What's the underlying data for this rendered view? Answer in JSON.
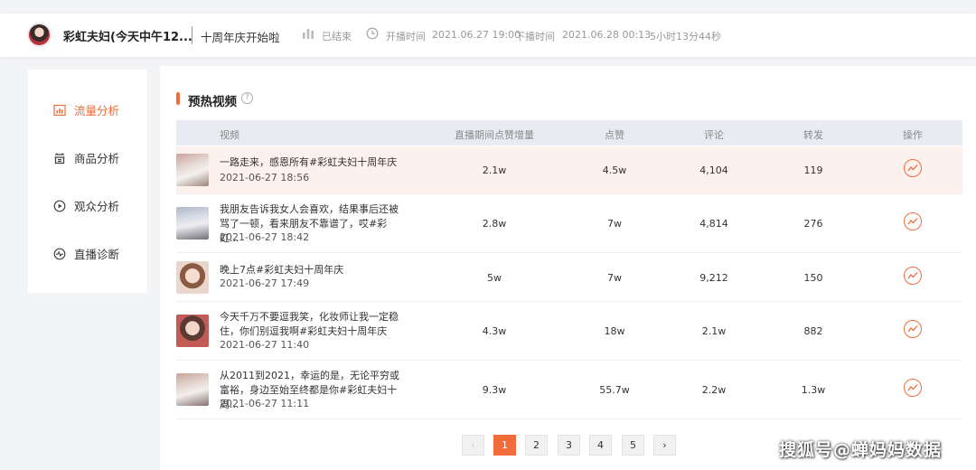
{
  "header": {
    "anchor_name": "彩虹夫妇(今天中午12...",
    "live_title": "十周年庆开始啦",
    "status": "已结束",
    "start_label": "开播时间",
    "start_time": "2021.06.27 19:00",
    "end_label": "下播时间",
    "end_time": "2021.06.28 00:13",
    "duration": "5小时13分44秒"
  },
  "sidebar": {
    "items": [
      {
        "label": "流量分析",
        "icon": "bar-chart-icon",
        "active": true
      },
      {
        "label": "商品分析",
        "icon": "goods-icon",
        "active": false
      },
      {
        "label": "观众分析",
        "icon": "play-circle-icon",
        "active": false
      },
      {
        "label": "直播诊断",
        "icon": "diagnose-icon",
        "active": false
      }
    ]
  },
  "section": {
    "title": "预热视频",
    "help": "?"
  },
  "table": {
    "headers": [
      "视频",
      "直播期间点赞增量",
      "点赞",
      "评论",
      "转发",
      "操作"
    ],
    "rows": [
      {
        "title": "一路走来，感恩所有#彩虹夫妇十周年庆",
        "date": "2021-06-27 18:56",
        "like_increase": "2.1w",
        "likes": "4.5w",
        "comments": "4,104",
        "shares": "119"
      },
      {
        "title": "我朋友告诉我女人会喜欢，结果事后还被骂了一顿，看来朋友不靠谱了，哎#彩虹...",
        "date": "2021-06-27 18:42",
        "like_increase": "2.8w",
        "likes": "7w",
        "comments": "4,814",
        "shares": "276"
      },
      {
        "title": "晚上7点#彩虹夫妇十周年庆",
        "date": "2021-06-27 17:49",
        "like_increase": "5w",
        "likes": "7w",
        "comments": "9,212",
        "shares": "150"
      },
      {
        "title": "今天千万不要逗我笑，化妆师让我一定稳住，你们别逗我啊#彩虹夫妇十周年庆",
        "date": "2021-06-27 11:40",
        "like_increase": "4.3w",
        "likes": "18w",
        "comments": "2.1w",
        "shares": "882"
      },
      {
        "title": "从2011到2021，幸运的是，无论平穷或富裕，身边至始至终都是你#彩虹夫妇十周...",
        "date": "2021-06-27 11:11",
        "like_increase": "9.3w",
        "likes": "55.7w",
        "comments": "2.2w",
        "shares": "1.3w"
      }
    ]
  },
  "pagination": {
    "prev": "‹",
    "next": "›",
    "pages": [
      "1",
      "2",
      "3",
      "4",
      "5"
    ],
    "current": "1"
  },
  "watermark": "搜狐号@蝉妈妈数据",
  "colors": {
    "accent": "#f26b3a",
    "header_bg": "#e8ecf2",
    "highlight_row": "#fdf1ee"
  }
}
